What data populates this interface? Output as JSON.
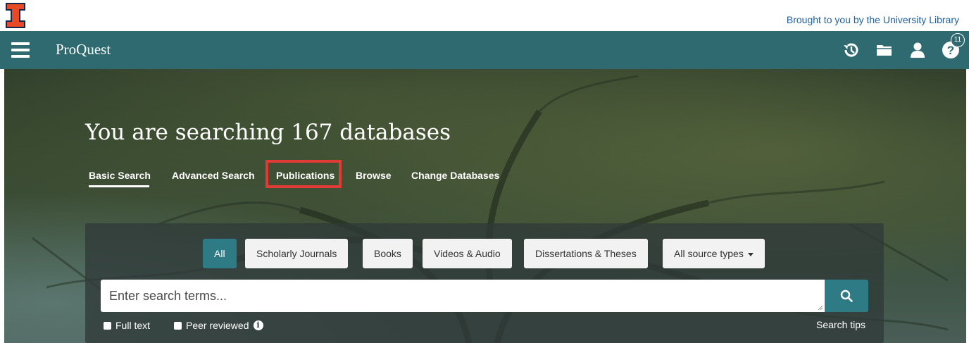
{
  "colors": {
    "nav_bg": "#2e6a70",
    "accent": "#2e7b85",
    "highlight": "#e23a35",
    "illinois_orange": "#e84a27",
    "link_blue": "#1f5f9e"
  },
  "topbar": {
    "brought_text": "Brought to you by the University Library",
    "logo_icon": "illinois-block-i-logo"
  },
  "navbar": {
    "brand": "ProQuest",
    "icons": [
      "menu-icon",
      "history-icon",
      "folder-icon",
      "user-icon",
      "help-icon"
    ],
    "help_badge": "11"
  },
  "hero": {
    "title": "You are searching 167 databases",
    "tabs": [
      {
        "label": "Basic Search",
        "active": true
      },
      {
        "label": "Advanced Search",
        "active": false
      },
      {
        "label": "Publications",
        "active": false,
        "highlighted": true
      },
      {
        "label": "Browse",
        "active": false
      },
      {
        "label": "Change Databases",
        "active": false
      }
    ]
  },
  "search": {
    "source_types": [
      {
        "label": "All",
        "active": true
      },
      {
        "label": "Scholarly Journals",
        "active": false
      },
      {
        "label": "Books",
        "active": false
      },
      {
        "label": "Videos & Audio",
        "active": false
      },
      {
        "label": "Dissertations & Theses",
        "active": false
      },
      {
        "label": "All source types",
        "active": false,
        "dropdown": true
      }
    ],
    "placeholder": "Enter search terms...",
    "value": "",
    "options": [
      {
        "label": "Full text",
        "checked": false
      },
      {
        "label": "Peer reviewed",
        "checked": false,
        "info": true
      }
    ],
    "tips_label": "Search tips"
  }
}
